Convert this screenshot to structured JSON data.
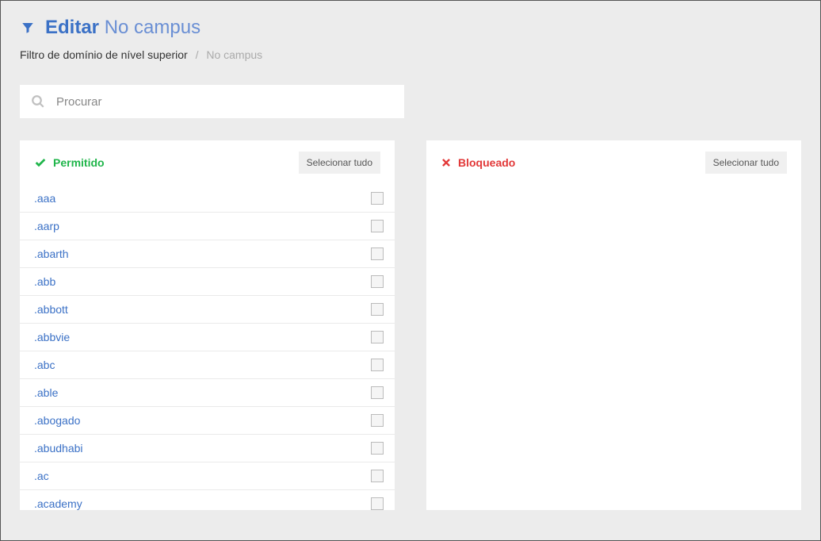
{
  "header": {
    "title_bold": "Editar",
    "title_light": "No campus"
  },
  "breadcrumb": {
    "parent": "Filtro de domínio de nível superior",
    "current": "No campus"
  },
  "search": {
    "placeholder": "Procurar"
  },
  "panel_allowed": {
    "title": "Permitido",
    "select_all": "Selecionar tudo",
    "domains": [
      ".aaa",
      ".aarp",
      ".abarth",
      ".abb",
      ".abbott",
      ".abbvie",
      ".abc",
      ".able",
      ".abogado",
      ".abudhabi",
      ".ac",
      ".academy"
    ]
  },
  "panel_blocked": {
    "title": "Bloqueado",
    "select_all": "Selecionar tudo",
    "domains": []
  }
}
